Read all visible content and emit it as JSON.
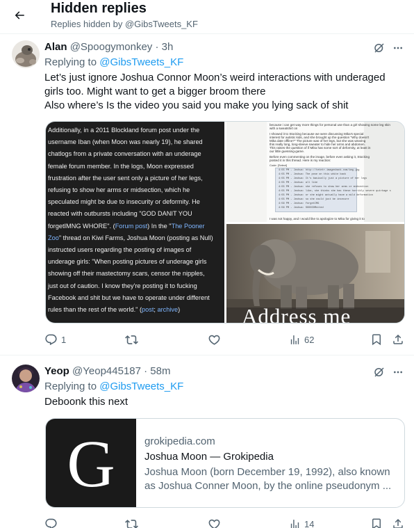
{
  "header": {
    "title": "Hidden replies",
    "subtitle": "Replies hidden by @GibsTweets_KF"
  },
  "tweets": [
    {
      "name": "Alan",
      "handle": "@Spoogymonkey",
      "time": "· 3h",
      "replying_prefix": "Replying to",
      "replying_to": "@GibsTweets_KF",
      "text_lines": [
        "Let’s just ignore Joshua Connor Moon’s weird interactions with underaged",
        "girls too. Might want to get a bigger broom there",
        "Also where’s Is the video you said you make you lying sack of shit"
      ],
      "media": {
        "left_lines": [
          "Additionally, in a 2011 Blockland forum post under the",
          "username Iban (when Moon was nearly 19), he shared",
          "chatlogs from a private conversation with an underage",
          "female forum member. In the logs, Moon expressed",
          "frustration after the user sent only a picture of her legs,",
          "refusing to show her arms or midsection, which he",
          "speculated might be due to insecurity or deformity. He",
          "reacted with outbursts including \"GOD DANIT YOU",
          "forgetIMNG WHORE\". (",
          "Forum post",
          ") In the \"",
          "The Pooner",
          "Zoo",
          "\" thread on Kiwi Farms, Joshua Moon (posting as Null)",
          "instructed users regarding the posting of images of",
          "underage girls: \"When posting pictures of underage girls",
          "showing off their mastectomy scars, censor the nipples,",
          "just out of caution. I know they're posting it to fucking",
          "Facebook and shit but we have to operate under different",
          "rules than the rest of the world.\" (",
          "post",
          "; ",
          "archive",
          ")"
        ],
        "doc_lines": [
          "because i can get way more things for personal use than a girl showing some leg skin",
          "with a sweatshirt on",
          "I showed it to Stocking because we were discussing Mika's special",
          "interest for autistic kids, and she brought up the question \"Why doesn't",
          "Mika date offline?\" The picture was of her legs, but she was wearing",
          "this really long, long-sleeve sweater to hide her arms and abdomen.",
          "This raises the question of if Mika has some sort of deformity, at least in",
          "our little guessing-game.",
          "Before even commenting on the image, before even asking it, Stocking",
          "posted it in this thread. Here is my reaction:",
          "I was not happy, and I would like to apologize to Mika for giving it to"
        ],
        "chat_label": "Code: [Select]",
        "chat_lines": [
          "4:55 PM - Joshua: http://tetetr.imageshack.com/img.jpg",
          "4:55 PM - Joshua: The pose on this white back",
          "4:55 PM - Joshua: It's basically just a picture of her legs",
          "4:55 PM - Joshua: all like",
          "4:55 PM - Joshua: she refuses to show her arms or midsection",
          "4:55 PM - Joshua: like, she thinks she has these horribly severe quirkage s",
          "4:55 PM - Joshua: or she might actually have a mild deformation",
          "4:55 PM - Joshua: so she could just be insecure",
          "4:56 PM - Joshua: forgetIMG",
          "4:56 PM - Joshua: SOOOOOMstted"
        ],
        "caption": "Address me"
      },
      "actions": {
        "replies": "1",
        "retweets": "",
        "likes": "",
        "views": "62"
      }
    },
    {
      "name": "Yeop",
      "handle": "@Yeop445187",
      "time": "· 58m",
      "replying_prefix": "Replying to",
      "replying_to": "@GibsTweets_KF",
      "text_lines": [
        "Deboonk this next"
      ],
      "card": {
        "thumb_letter": "G",
        "domain": "grokipedia.com",
        "title": "Joshua Moon — Grokipedia",
        "desc_lines": [
          "Joshua Moon (born December 19, 1992), also known",
          "as Joshua Conner Moon, by the online pseudonym ..."
        ]
      },
      "actions": {
        "replies": "",
        "retweets": "",
        "likes": "",
        "views": "14"
      }
    }
  ],
  "colors": {
    "link": "#1d9bf0",
    "secondary_text": "#536471",
    "primary_text": "#0f1419",
    "border": "#cfd9de"
  },
  "icons": [
    "back-arrow-icon",
    "hide-reply-icon",
    "more-icon",
    "reply-icon",
    "retweet-icon",
    "like-icon",
    "views-icon",
    "bookmark-icon",
    "share-icon"
  ]
}
